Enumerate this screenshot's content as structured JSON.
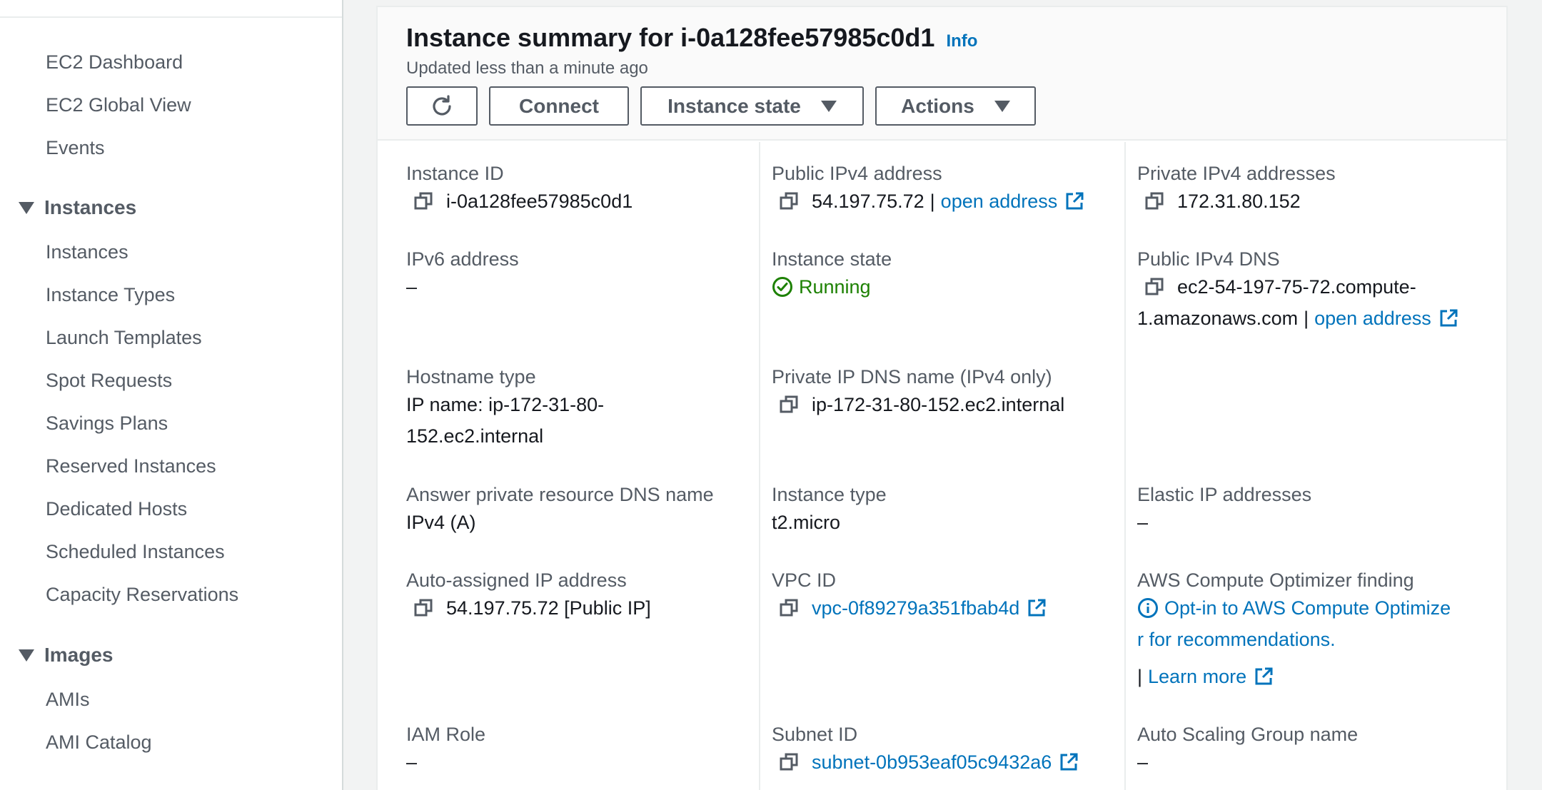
{
  "sidebar": {
    "items_top": [
      "EC2 Dashboard",
      "EC2 Global View",
      "Events"
    ],
    "instances_section": "Instances",
    "instances_items": [
      "Instances",
      "Instance Types",
      "Launch Templates",
      "Spot Requests",
      "Savings Plans",
      "Reserved Instances",
      "Dedicated Hosts",
      "Scheduled Instances",
      "Capacity Reservations"
    ],
    "images_section": "Images",
    "images_items": [
      "AMIs",
      "AMI Catalog"
    ]
  },
  "header": {
    "title": "Instance summary for i-0a128fee57985c0d1",
    "info": "Info",
    "updated": "Updated less than a minute ago",
    "buttons": {
      "refresh_icon": "refresh-icon",
      "connect": "Connect",
      "instance_state": "Instance state",
      "actions": "Actions"
    }
  },
  "details": {
    "instance_id": {
      "label": "Instance ID",
      "value": "i-0a128fee57985c0d1"
    },
    "public_ipv4": {
      "label": "Public IPv4 address",
      "value": "54.197.75.72",
      "separator": "|",
      "link": "open address"
    },
    "private_ipv4": {
      "label": "Private IPv4 addresses",
      "value": "172.31.80.152"
    },
    "ipv6": {
      "label": "IPv6 address",
      "value": "–"
    },
    "instance_state": {
      "label": "Instance state",
      "value": "Running"
    },
    "public_dns": {
      "label": "Public IPv4 DNS",
      "value_line1": "ec2-54-197-75-72.compute-",
      "value_line2": "1.amazonaws.com",
      "separator": "|",
      "link": "open address"
    },
    "hostname_type": {
      "label": "Hostname type",
      "value_line1": "IP name: ip-172-31-80-",
      "value_line2": "152.ec2.internal"
    },
    "private_dns": {
      "label": "Private IP DNS name (IPv4 only)",
      "value": "ip-172-31-80-152.ec2.internal"
    },
    "answer_dns": {
      "label": "Answer private resource DNS name",
      "value": "IPv4 (A)"
    },
    "instance_type": {
      "label": "Instance type",
      "value": "t2.micro"
    },
    "elastic_ip": {
      "label": "Elastic IP addresses",
      "value": "–"
    },
    "auto_ip": {
      "label": "Auto-assigned IP address",
      "value": "54.197.75.72 [Public IP]"
    },
    "vpc_id": {
      "label": "VPC ID",
      "value": "vpc-0f89279a351fbab4d"
    },
    "optimizer": {
      "label": "AWS Compute Optimizer finding",
      "line1": "Opt-in to AWS Compute Optimize",
      "line2": "r for recommendations.",
      "separator": "|",
      "learn_more": "Learn more"
    },
    "iam_role": {
      "label": "IAM Role",
      "value": "–"
    },
    "subnet_id": {
      "label": "Subnet ID",
      "value": "subnet-0b953eaf05c9432a6"
    },
    "asg_name": {
      "label": "Auto Scaling Group name",
      "value": "–"
    }
  },
  "colors": {
    "link": "#0073bb",
    "running": "#1d8102",
    "text": "#16191f",
    "muted": "#545b64"
  }
}
